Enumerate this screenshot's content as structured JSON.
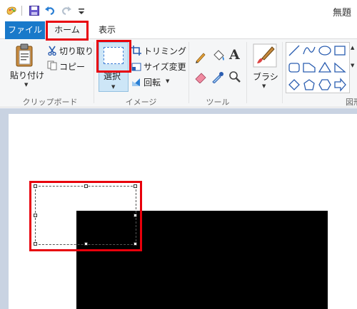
{
  "window": {
    "title": "無題"
  },
  "qat": {
    "items": [
      "paint-app-icon",
      "save-icon",
      "undo-icon",
      "redo-icon",
      "customize-dropdown-icon"
    ]
  },
  "tabs": [
    {
      "label": "ファイル"
    },
    {
      "label": "ホーム"
    },
    {
      "label": "表示"
    }
  ],
  "clipboard": {
    "paste_label": "貼り付け",
    "cut_label": "切り取り",
    "copy_label": "コピー",
    "group_label": "クリップボード"
  },
  "image": {
    "select_label": "選択",
    "crop_label": "トリミング",
    "resize_label": "サイズ変更",
    "rotate_label": "回転",
    "group_label": "イメージ"
  },
  "tools": {
    "group_label": "ツール",
    "items": [
      "pencil-icon",
      "fill-icon",
      "text-icon",
      "eraser-icon",
      "color-picker-icon",
      "magnifier-icon"
    ]
  },
  "brushes": {
    "label": "ブラシ"
  },
  "shapes": {
    "group_label": "図形"
  },
  "colors": {
    "accent": "#1979ca",
    "highlight": "#e8000b",
    "selected_button": "#cde6f7"
  }
}
